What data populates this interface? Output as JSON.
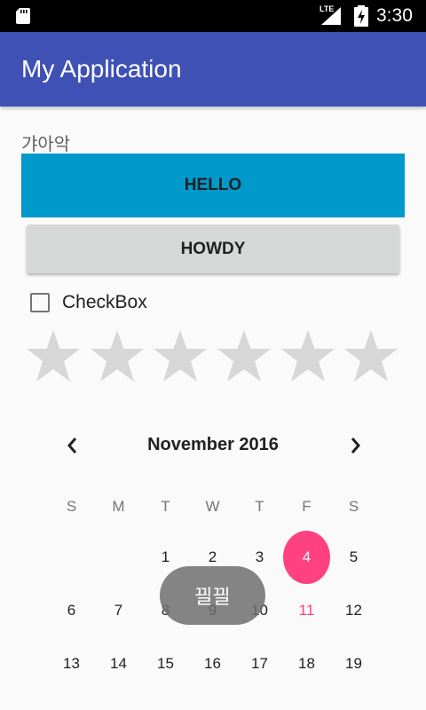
{
  "status_bar": {
    "time": "3:30",
    "network": "LTE",
    "icons": [
      "sd-card-icon",
      "signal-icon",
      "battery-icon"
    ]
  },
  "app_bar": {
    "title": "My Application",
    "color": "#3f51b5"
  },
  "content": {
    "label": "갸아악",
    "hello_button": "HELLO",
    "howdy_button": "HOWDY",
    "checkbox": {
      "label": "CheckBox",
      "checked": false
    },
    "rating": {
      "stars_total": 6,
      "stars_filled": 0
    }
  },
  "calendar": {
    "month": "November 2016",
    "weekdays": [
      "S",
      "M",
      "T",
      "W",
      "T",
      "F",
      "S"
    ],
    "weeks": [
      [
        "",
        "",
        "1",
        "2",
        "3",
        "4",
        "5"
      ],
      [
        "6",
        "7",
        "8",
        "9",
        "10",
        "11",
        "12"
      ],
      [
        "13",
        "14",
        "15",
        "16",
        "17",
        "18",
        "19"
      ]
    ],
    "selected_day": "4",
    "today": "11",
    "accent": "#ff4081"
  },
  "toast": {
    "text": "끨끨"
  }
}
